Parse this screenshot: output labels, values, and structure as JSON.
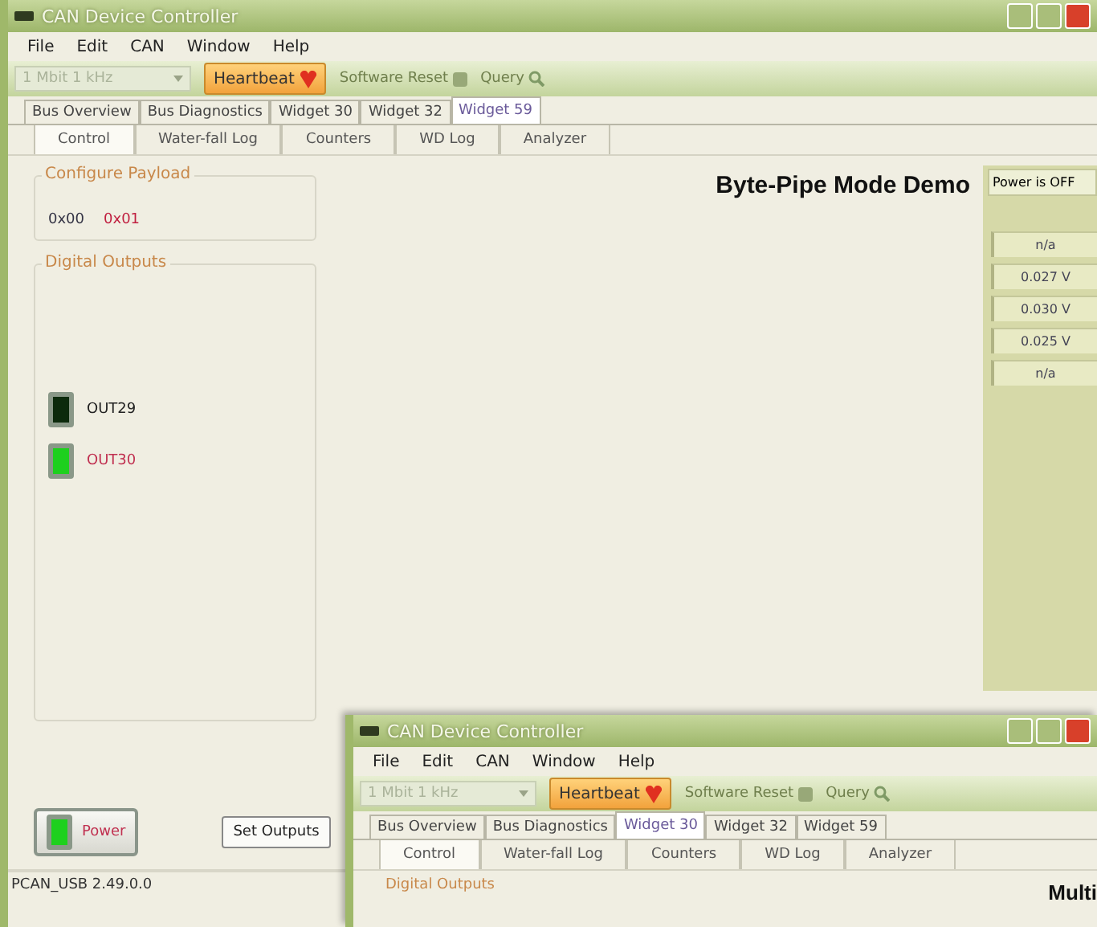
{
  "main_window": {
    "title": "CAN Device Controller",
    "menu": [
      "File",
      "Edit",
      "CAN",
      "Window",
      "Help"
    ],
    "toolbar": {
      "combo": "1 Mbit 1 kHz",
      "heartbeat": "Heartbeat",
      "software_reset": "Software Reset",
      "query": "Query"
    },
    "tabs": [
      {
        "label": "Bus Overview",
        "selected": false
      },
      {
        "label": "Bus Diagnostics",
        "selected": false
      },
      {
        "label": "Widget 30",
        "selected": false
      },
      {
        "label": "Widget 32",
        "selected": false
      },
      {
        "label": "Widget 59",
        "selected": true
      }
    ],
    "subtabs": [
      {
        "label": "Control",
        "selected": true
      },
      {
        "label": "Water-fall Log",
        "selected": false
      },
      {
        "label": "Counters",
        "selected": false
      },
      {
        "label": "WD Log",
        "selected": false
      },
      {
        "label": "Analyzer",
        "selected": false
      }
    ],
    "configure_payload": {
      "title": "Configure Payload",
      "bytes": [
        {
          "label": "0x00",
          "changed": false
        },
        {
          "label": "0x01",
          "changed": true
        }
      ]
    },
    "digital_outputs": {
      "title": "Digital Outputs",
      "outputs": [
        {
          "label": "OUT29",
          "on": false
        },
        {
          "label": "OUT30",
          "on": true
        }
      ]
    },
    "power_button": {
      "label": "Power",
      "on": true
    },
    "set_outputs": "Set Outputs",
    "heading": "Byte-Pipe Mode Demo",
    "power_status": "Power is OFF",
    "readings": [
      "n/a",
      "0.027 V",
      "0.030 V",
      "0.025 V",
      "n/a"
    ],
    "status_bar": "PCAN_USB 2.49.0.0"
  },
  "second_window": {
    "title": "CAN Device Controller",
    "menu": [
      "File",
      "Edit",
      "CAN",
      "Window",
      "Help"
    ],
    "toolbar": {
      "combo": "1 Mbit 1 kHz",
      "heartbeat": "Heartbeat",
      "software_reset": "Software Reset",
      "query": "Query"
    },
    "tabs": [
      {
        "label": "Bus Overview",
        "selected": false
      },
      {
        "label": "Bus Diagnostics",
        "selected": false
      },
      {
        "label": "Widget 30",
        "selected": true
      },
      {
        "label": "Widget 32",
        "selected": false
      },
      {
        "label": "Widget 59",
        "selected": false
      }
    ],
    "subtabs": [
      {
        "label": "Control",
        "selected": true
      },
      {
        "label": "Water-fall Log",
        "selected": false
      },
      {
        "label": "Counters",
        "selected": false
      },
      {
        "label": "WD Log",
        "selected": false
      },
      {
        "label": "Analyzer",
        "selected": false
      }
    ],
    "group_title": "Digital Outputs",
    "heading": "Multi"
  }
}
